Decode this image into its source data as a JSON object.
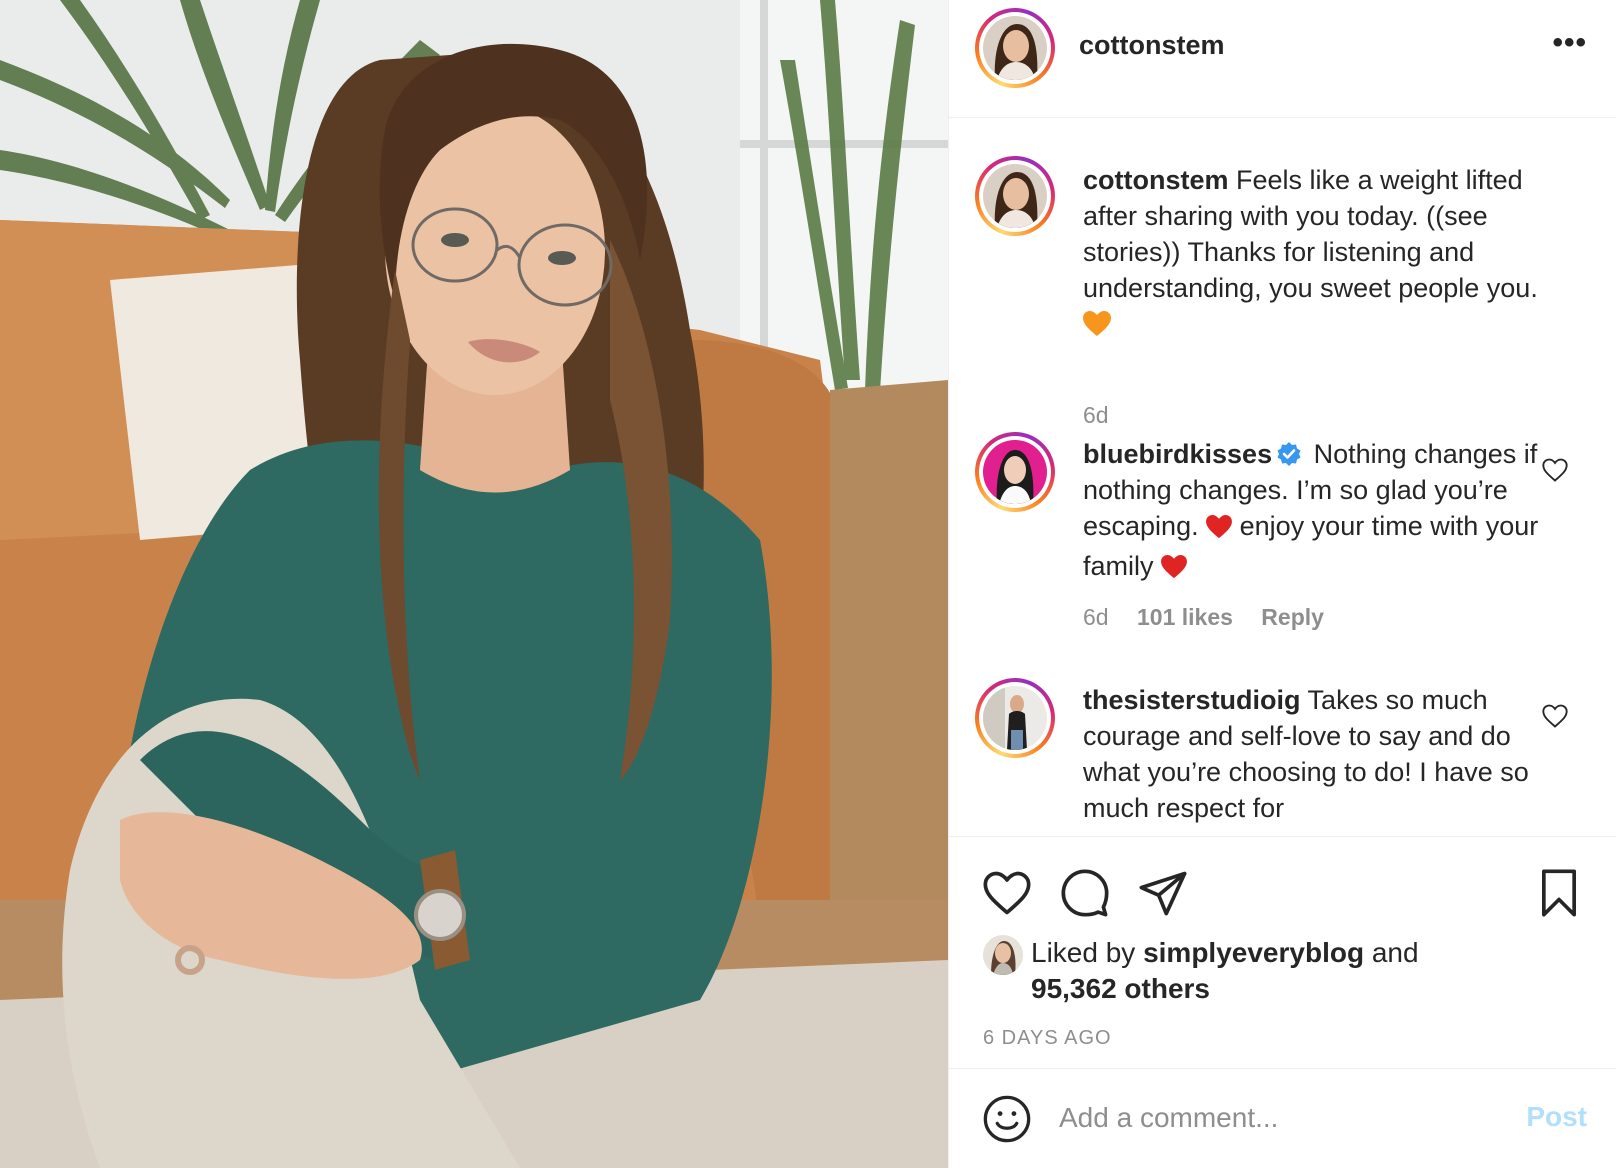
{
  "post": {
    "username": "cottonstem",
    "more_label": "•••"
  },
  "comments": [
    {
      "user": "cottonstem",
      "text": "Feels like a weight lifted after sharing with you today. ((see stories)) Thanks for listening and understanding, you sweet people you.",
      "emoji": "orange-heart",
      "age": "6d"
    },
    {
      "user": "bluebirdkisses",
      "verified": true,
      "text_a": "Nothing changes if nothing changes. I’m so glad you’re escaping.",
      "text_b": "enjoy your time with your family",
      "age": "6d",
      "likes": "101 likes",
      "reply": "Reply"
    },
    {
      "user": "thesisterstudioig",
      "text": "Takes so much courage and self-love to say and do what you’re choosing to do! I have so much respect for"
    }
  ],
  "likes": {
    "prefix": "Liked by",
    "user": "simplyeveryblog",
    "suffix": "and",
    "others": "95,362 others"
  },
  "timestamp": "6 DAYS AGO",
  "add_comment": {
    "placeholder": "Add a comment...",
    "post_label": "Post"
  },
  "colors": {
    "link_disabled": "#b2dffc",
    "muted_text": "#8e8e8e",
    "heart_red": "#e02424",
    "orange_heart": "#f7961d",
    "verified_blue": "#3897f0"
  }
}
